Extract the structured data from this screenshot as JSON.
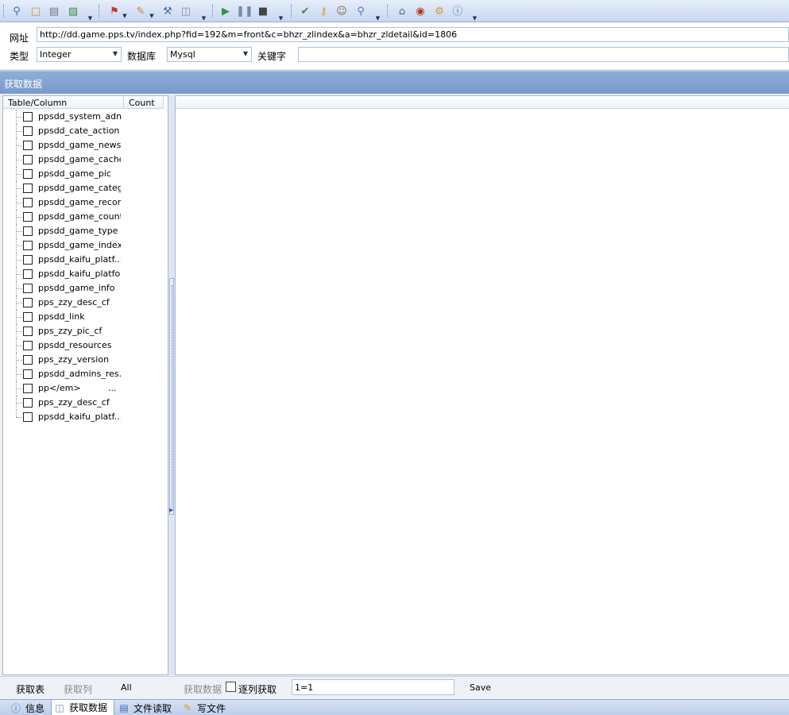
{
  "toolbar": {
    "icons": [
      "search-icon",
      "open-icon",
      "document-icon",
      "save-exit-icon",
      "flag-menu-icon",
      "tools-menu-icon",
      "wrench-icon",
      "database-icon",
      "play-icon",
      "pause-icon",
      "stop-icon",
      "help-icon",
      "key-icon",
      "users-icon",
      "magnifier-icon",
      "home-icon",
      "bug-icon",
      "gear-icon",
      "info-icon"
    ]
  },
  "address": {
    "url_label": "网址",
    "url_value": "http://dd.game.pps.tv/index.php?fid=192&m=front&c=bhzr_zlindex&a=bhzr_zldetail&id=1806",
    "type_label": "类型",
    "type_value": "Integer",
    "db_label": "数据库",
    "db_value": "Mysql",
    "keyword_label": "关键字",
    "keyword_value": ""
  },
  "section": {
    "title": "获取数据"
  },
  "tree": {
    "col_table": "Table/Column",
    "col_count": "Count",
    "items": [
      {
        "name": "ppsdd_system_admin",
        "count": ""
      },
      {
        "name": "ppsdd_cate_action",
        "count": ""
      },
      {
        "name": "ppsdd_game_news",
        "count": ""
      },
      {
        "name": "ppsdd_game_cache",
        "count": ""
      },
      {
        "name": "ppsdd_game_pic",
        "count": ""
      },
      {
        "name": "ppsdd_game_category",
        "count": ""
      },
      {
        "name": "ppsdd_game_recommend",
        "count": ""
      },
      {
        "name": "ppsdd_game_count",
        "count": ""
      },
      {
        "name": "ppsdd_game_type",
        "count": ""
      },
      {
        "name": "ppsdd_game_index",
        "count": ""
      },
      {
        "name": "ppsdd_kaifu_platf...",
        "count": ""
      },
      {
        "name": "ppsdd_kaifu_platform",
        "count": ""
      },
      {
        "name": "ppsdd_game_info",
        "count": ""
      },
      {
        "name": "pps_zzy_desc_cf",
        "count": ""
      },
      {
        "name": "ppsdd_link",
        "count": ""
      },
      {
        "name": "pps_zzy_pic_cf",
        "count": ""
      },
      {
        "name": "ppsdd_resources",
        "count": ""
      },
      {
        "name": "pps_zzy_version",
        "count": ""
      },
      {
        "name": "ppsdd_admins_res...",
        "count": ""
      },
      {
        "name": "pp</em>",
        "count": "..."
      },
      {
        "name": "pps_zzy_desc_cf",
        "count": ""
      },
      {
        "name": "ppsdd_kaifu_platf...",
        "count": ""
      }
    ]
  },
  "bottom": {
    "get_tables": "获取表",
    "get_columns": "获取列",
    "all": "All",
    "get_data": "获取数据",
    "per_column_label": "逐列获取",
    "condition_value": "1=1",
    "save": "Save"
  },
  "tabs": [
    {
      "label": "信息",
      "icon": "info-icon",
      "active": false
    },
    {
      "label": "获取数据",
      "icon": "database-icon",
      "active": true
    },
    {
      "label": "文件读取",
      "icon": "file-icon",
      "active": false
    },
    {
      "label": "写文件",
      "icon": "write-file-icon",
      "active": false
    }
  ]
}
